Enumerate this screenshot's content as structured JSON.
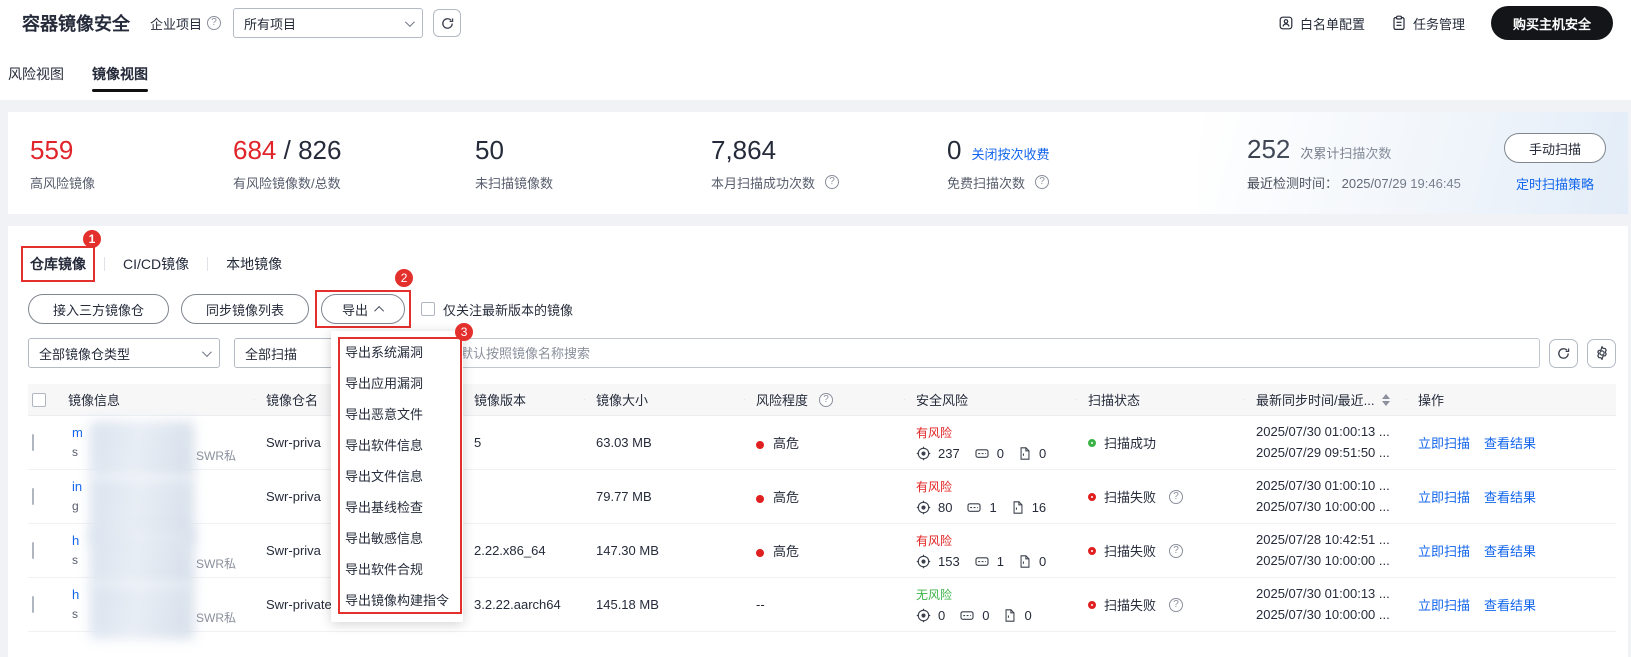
{
  "colors": {
    "accent_red": "#e0242a",
    "annotation_red": "#e3302d",
    "link_blue": "#1366ec",
    "green": "#3bb346"
  },
  "header": {
    "title": "容器镜像安全",
    "enterprise_project_label": "企业项目",
    "project_select_value": "所有项目",
    "whitelist_action": "白名单配置",
    "task_action": "任务管理",
    "buy_button": "购买主机安全"
  },
  "view_tabs": {
    "risk": "风险视图",
    "image": "镜像视图"
  },
  "stats": {
    "items": [
      {
        "value": "559",
        "label": "高风险镜像"
      },
      {
        "value": "684",
        "value2": "/ 826",
        "label": "有风险镜像数/总数"
      },
      {
        "value": "50",
        "label": "未扫描镜像数"
      },
      {
        "value": "7,864",
        "label": "本月扫描成功次数"
      },
      {
        "value": "0",
        "link": "关闭按次收费",
        "label": "免费扫描次数"
      },
      {
        "value": "252",
        "suffix": "次累计扫描次数",
        "sub": "最近检测时间： 2025/07/29 19:46:45"
      }
    ],
    "manual_scan_button": "手动扫描",
    "schedule_link": "定时扫描策略"
  },
  "image_tabs": {
    "repo": "仓库镜像",
    "cicd": "CI/CD镜像",
    "local": "本地镜像"
  },
  "annotations": {
    "badge1": "1",
    "badge2": "2",
    "badge3": "3"
  },
  "toolbar": {
    "access_button": "接入三方镜像仓",
    "sync_button": "同步镜像列表",
    "export_button": "导出",
    "checkbox_label": "仅关注最新版本的镜像"
  },
  "export_menu": {
    "items": [
      "导出系统漏洞",
      "导出应用漏洞",
      "导出恶意文件",
      "导出软件信息",
      "导出文件信息",
      "导出基线检查",
      "导出敏感信息",
      "导出软件合规",
      "导出镜像构建指令"
    ]
  },
  "filters": {
    "repo_type_value": "全部镜像仓类型",
    "scan_status_value": "全部扫描",
    "search_placeholder": "默认按照镜像名称搜索"
  },
  "table": {
    "columns": [
      "镜像信息",
      "镜像仓名",
      "镜像版本",
      "镜像大小",
      "风险程度",
      "安全风险",
      "扫描状态",
      "最新同步时间/最近...",
      "操作"
    ],
    "rows": [
      {
        "name_prefix1": "m",
        "name_prefix2": "s",
        "tag": "SWR私",
        "repo": "Swr-priva",
        "version": "5",
        "size": "63.03 MB",
        "risk_level": "高危",
        "risk_status": "有风险",
        "risk_safe": false,
        "vuln": "237",
        "malware": "0",
        "files": "0",
        "scan_status": "扫描成功",
        "scan_ok": true,
        "scan_help": false,
        "time1": "2025/07/30 01:00:13 ...",
        "time2": "2025/07/29 09:51:50 ...",
        "action1": "立即扫描",
        "action2": "查看结果"
      },
      {
        "name_prefix1": "in",
        "name_prefix2": "g",
        "tag": "",
        "repo": "Swr-priva",
        "version": "",
        "size": "79.77 MB",
        "risk_level": "高危",
        "risk_status": "有风险",
        "risk_safe": false,
        "vuln": "80",
        "malware": "1",
        "files": "16",
        "scan_status": "扫描失败",
        "scan_ok": false,
        "scan_help": true,
        "time1": "2025/07/30 01:00:10 ...",
        "time2": "2025/07/30 10:00:00 ...",
        "action1": "立即扫描",
        "action2": "查看结果"
      },
      {
        "name_prefix1": "h",
        "name_prefix2": "s",
        "tag": "SWR私",
        "repo": "Swr-priva",
        "version": "2.22.x86_64",
        "size": "147.30 MB",
        "risk_level": "高危",
        "risk_status": "有风险",
        "risk_safe": false,
        "vuln": "153",
        "malware": "1",
        "files": "0",
        "scan_status": "扫描失败",
        "scan_ok": false,
        "scan_help": true,
        "time1": "2025/07/28 10:42:51 ...",
        "time2": "2025/07/30 10:00:00 ...",
        "action1": "立即扫描",
        "action2": "查看结果"
      },
      {
        "name_prefix1": "h",
        "name_prefix2": "s",
        "tag": "SWR私",
        "repo": "Swr-private",
        "version": "3.2.22.aarch64",
        "size": "145.18 MB",
        "risk_level": "--",
        "risk_status": "无风险",
        "risk_safe": true,
        "vuln": "0",
        "malware": "0",
        "files": "0",
        "scan_status": "扫描失败",
        "scan_ok": false,
        "scan_help": true,
        "time1": "2025/07/30 01:00:13 ...",
        "time2": "2025/07/30 10:00:00 ...",
        "action1": "立即扫描",
        "action2": "查看结果"
      }
    ]
  }
}
